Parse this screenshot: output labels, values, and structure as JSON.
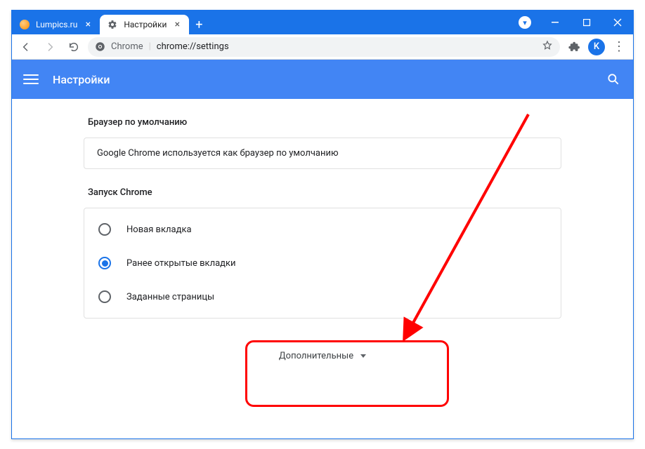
{
  "window": {
    "tabs": [
      {
        "title": "Lumpics.ru",
        "active": false
      },
      {
        "title": "Настройки",
        "active": true
      }
    ],
    "profile_glyph": "▾"
  },
  "addressbar": {
    "scheme_label": "Chrome",
    "url": "chrome://settings",
    "avatar_letter": "K"
  },
  "settings": {
    "header_title": "Настройки",
    "section_default_browser": {
      "label": "Браузер по умолчанию",
      "status_text": "Google Chrome используется как браузер по умолчанию"
    },
    "section_startup": {
      "label": "Запуск Chrome",
      "options": [
        "Новая вкладка",
        "Ранее открытые вкладки",
        "Заданные страницы"
      ],
      "selected_index": 1
    },
    "advanced_label": "Дополнительные"
  }
}
